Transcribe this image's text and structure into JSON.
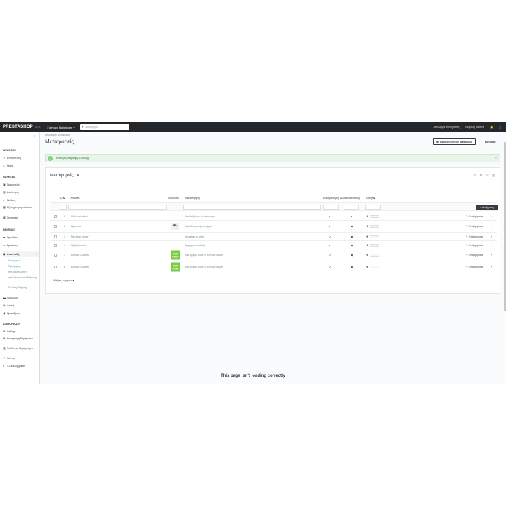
{
  "topbar": {
    "logo": "PRESTASHOP",
    "version": "8.1.x",
    "quick_access": "Γρήγορη Πρόσβαση ▾",
    "search_placeholder": "Αναζήτηση",
    "right_items": [
      "Λειτουργία συντήρησης",
      "Προβολή κατάστ.",
      "🔔",
      "👤"
    ]
  },
  "sidebar": {
    "sections": [
      {
        "title": "WELCOME",
        "items": [
          "Επισκόπηση",
          "Home"
        ]
      },
      {
        "title": "ΠΩΛΗΣΕΙΣ",
        "items": [
          "Παραγγελίες",
          "Κατάλογος",
          "Πελάτες",
          "Εξυπηρέτηση πελατών",
          "Στατιστικά"
        ]
      },
      {
        "title": "ΒΕΛΤΙΩΣΗ",
        "items": [
          "Πρόσθετα",
          "Εμφάνιση",
          "Αποστολή"
        ],
        "sub": [
          "Μεταφορείς",
          "Προτιμήσεις",
          "myCustomCarrier",
          "myCustomCarrier Shipping",
          "My Easy Shipping"
        ]
      },
      {
        "title": "",
        "items": [
          "Πληρωμή",
          "Διεθνή",
          "Προωθήσεις"
        ]
      },
      {
        "title": "ΔΙΑΜΟΡΦΩΣΗ",
        "items": [
          "Settings",
          "Καταγραφή Παράμετροι",
          "Σύνδεσμοι Παραμέτρων",
          "Κόστος",
          "1-Click Upgrade"
        ]
      }
    ]
  },
  "breadcrumb": [
    "Αποστολή",
    "Μεταφορείς"
  ],
  "page_title": "Μεταφορείς",
  "add_button": "Προσθήκη νέου μεταφορέα",
  "help_button": "Βοήθεια",
  "alert": "Επιτυχής διαγραφή: Ολοκληρ",
  "panel": {
    "title": "Μεταφορείς",
    "count": "6",
    "columns": {
      "id": "ID ▾▴",
      "name": "Όνομα ▾▴",
      "logo": "Λογότυπο",
      "delay": "Καθυστέρηση",
      "status": "Ενεργοποίηση",
      "free": "Δωρεάν αποστολή",
      "position": "Θέση ▾▴"
    },
    "search_button": "Αναζήτηση",
    "edit_label": "Επεξεργασία",
    "bulk_actions": "Μαζικές ενέργειες ▴",
    "rows": [
      {
        "id": "1",
        "name": "Click and collect",
        "logo": "",
        "delay": "Παραλαβή από το κατάστημα",
        "active": true,
        "free": true
      },
      {
        "id": "2",
        "name": "My carrier",
        "logo": "truck",
        "delay": "Παράδοση επόμενη μέρα!",
        "active": true,
        "free": false
      },
      {
        "id": "3",
        "name": "My cheap carrier",
        "logo": "",
        "delay": "Θα φτάσει το μήνα",
        "active": true,
        "free": false
      },
      {
        "id": "4",
        "name": "My light carrier",
        "logo": "",
        "delay": "Γρήγορη αποστολή",
        "active": true,
        "free": false
      },
      {
        "id": "7",
        "name": "BoxNow Lockers",
        "logo": "box",
        "delay": "Pick up your order in BoxNow lockers",
        "active": true,
        "free": false
      },
      {
        "id": "8",
        "name": "BoxNow Lockers",
        "logo": "box",
        "delay": "Pick up your order in BoxNow lockers",
        "active": true,
        "free": false
      }
    ]
  },
  "box_logo_text": [
    "BOX",
    "NOW"
  ],
  "loading_text": "This page isn’t loading correctly",
  "colors": {
    "topbar": "#25282b",
    "accent": "#25b9d7",
    "success": "#78d07d",
    "boxnow": "#7ac943"
  }
}
